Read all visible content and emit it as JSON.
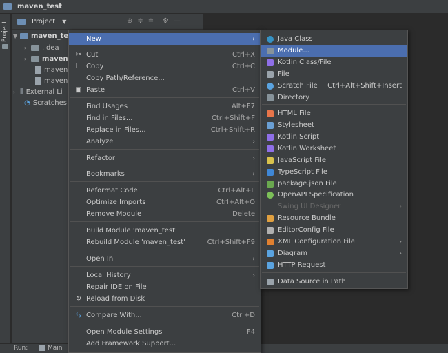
{
  "window": {
    "title": "maven_test"
  },
  "sidebar_tab": "Project",
  "project_panel": {
    "header_label": "Project",
    "tree": [
      {
        "label": "maven_te",
        "bold": true
      },
      {
        "label": ".idea"
      },
      {
        "label": "maven",
        "bold": true
      },
      {
        "label": "maven_"
      },
      {
        "label": "maven_"
      },
      {
        "label": "External Li"
      },
      {
        "label": "Scratches"
      }
    ]
  },
  "bottom_bar": {
    "run_label": "Run:",
    "tab_label": "Main"
  },
  "context_menu": {
    "items": [
      {
        "label": "New",
        "icon": "",
        "shortcut": "",
        "submenu": true,
        "selected": true
      },
      {
        "label": "Cut",
        "icon": "scissors-icon",
        "shortcut": "Ctrl+X"
      },
      {
        "label": "Copy",
        "icon": "copy-icon",
        "shortcut": "Ctrl+C"
      },
      {
        "label": "Copy Path/Reference...",
        "icon": "",
        "shortcut": ""
      },
      {
        "label": "Paste",
        "icon": "paste-icon",
        "shortcut": "Ctrl+V"
      },
      {
        "label": "Find Usages",
        "icon": "",
        "shortcut": "Alt+F7"
      },
      {
        "label": "Find in Files...",
        "icon": "",
        "shortcut": "Ctrl+Shift+F"
      },
      {
        "label": "Replace in Files...",
        "icon": "",
        "shortcut": "Ctrl+Shift+R"
      },
      {
        "label": "Analyze",
        "icon": "",
        "shortcut": "",
        "submenu": true
      },
      {
        "label": "Refactor",
        "icon": "",
        "shortcut": "",
        "submenu": true
      },
      {
        "label": "Bookmarks",
        "icon": "",
        "shortcut": "",
        "submenu": true
      },
      {
        "label": "Reformat Code",
        "icon": "",
        "shortcut": "Ctrl+Alt+L"
      },
      {
        "label": "Optimize Imports",
        "icon": "",
        "shortcut": "Ctrl+Alt+O"
      },
      {
        "label": "Remove Module",
        "icon": "",
        "shortcut": "Delete"
      },
      {
        "label": "Build Module 'maven_test'",
        "icon": "",
        "shortcut": ""
      },
      {
        "label": "Rebuild Module 'maven_test'",
        "icon": "",
        "shortcut": "Ctrl+Shift+F9"
      },
      {
        "label": "Open In",
        "icon": "",
        "shortcut": "",
        "submenu": true
      },
      {
        "label": "Local History",
        "icon": "",
        "shortcut": "",
        "submenu": true
      },
      {
        "label": "Repair IDE on File",
        "icon": "",
        "shortcut": ""
      },
      {
        "label": "Reload from Disk",
        "icon": "reload-icon",
        "shortcut": ""
      },
      {
        "label": "Compare With...",
        "icon": "compare-icon",
        "shortcut": "Ctrl+D"
      },
      {
        "label": "Open Module Settings",
        "icon": "",
        "shortcut": "F4"
      },
      {
        "label": "Add Framework Support...",
        "icon": "",
        "shortcut": ""
      }
    ]
  },
  "submenu_new": {
    "items": [
      {
        "label": "Java Class",
        "icon": "java-class-icon",
        "color": "#3592c4"
      },
      {
        "label": "Module...",
        "icon": "module-icon",
        "color": "#87939a",
        "selected": true
      },
      {
        "label": "Kotlin Class/File",
        "icon": "kotlin-icon",
        "color": "#8f6fe8"
      },
      {
        "label": "File",
        "icon": "file-icon",
        "color": "#9aa3ab"
      },
      {
        "label": "Scratch File",
        "icon": "scratch-icon",
        "color": "#5aa3e0",
        "shortcut": "Ctrl+Alt+Shift+Insert"
      },
      {
        "label": "Directory",
        "icon": "folder-icon",
        "color": "#87939a"
      },
      {
        "label": "HTML File",
        "icon": "html-icon",
        "color": "#e8754a"
      },
      {
        "label": "Stylesheet",
        "icon": "css-icon",
        "color": "#6a9fd4"
      },
      {
        "label": "Kotlin Script",
        "icon": "kotlin-script-icon",
        "color": "#8f6fe8"
      },
      {
        "label": "Kotlin Worksheet",
        "icon": "kotlin-worksheet-icon",
        "color": "#8f6fe8"
      },
      {
        "label": "JavaScript File",
        "icon": "js-icon",
        "color": "#d9c24c"
      },
      {
        "label": "TypeScript File",
        "icon": "ts-icon",
        "color": "#3f87d6"
      },
      {
        "label": "package.json File",
        "icon": "npm-icon",
        "color": "#6aa84f"
      },
      {
        "label": "OpenAPI Specification",
        "icon": "openapi-icon",
        "color": "#7cbf58"
      },
      {
        "label": "Swing UI Designer",
        "icon": "",
        "disabled": true,
        "submenu": true
      },
      {
        "label": "Resource Bundle",
        "icon": "resource-bundle-icon",
        "color": "#e0a040"
      },
      {
        "label": "EditorConfig File",
        "icon": "editorconfig-icon",
        "color": "#b0b0b0"
      },
      {
        "label": "XML Configuration File",
        "icon": "xml-icon",
        "color": "#e08030",
        "submenu": true
      },
      {
        "label": "Diagram",
        "icon": "diagram-icon",
        "color": "#5aa3e0",
        "submenu": true
      },
      {
        "label": "HTTP Request",
        "icon": "http-icon",
        "color": "#5aa3e0"
      },
      {
        "label": "Data Source in Path",
        "icon": "database-icon",
        "color": "#9aa3ab"
      }
    ]
  }
}
